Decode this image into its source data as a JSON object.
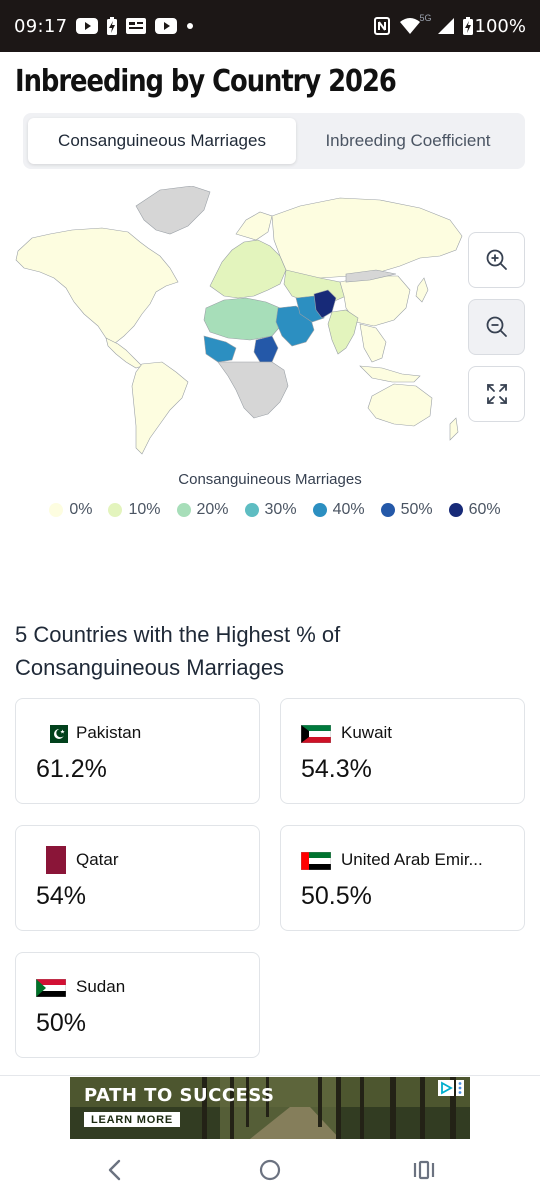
{
  "status_bar": {
    "time": "09:17",
    "battery": "100%",
    "network": "5G",
    "icons": [
      "youtube-icon",
      "battery-saver-icon",
      "news-icon",
      "youtube-icon",
      "notification-dot-icon",
      "nfc-icon",
      "wifi-icon",
      "signal-icon",
      "battery-icon"
    ]
  },
  "page": {
    "title": "Inbreeding by Country 2026"
  },
  "tabs": [
    {
      "label": "Consanguineous Marriages",
      "selected": true
    },
    {
      "label": "Inbreeding Coefficient",
      "selected": false
    }
  ],
  "map": {
    "controls": [
      "zoom-in-icon",
      "zoom-out-icon",
      "fullscreen-icon"
    ],
    "legend_title": "Consanguineous Marriages",
    "legend": [
      {
        "label": "0%",
        "color": "#fdfde0"
      },
      {
        "label": "10%",
        "color": "#e3f4bd"
      },
      {
        "label": "20%",
        "color": "#a7deb9"
      },
      {
        "label": "30%",
        "color": "#5ebdc2"
      },
      {
        "label": "40%",
        "color": "#2c8fc1"
      },
      {
        "label": "50%",
        "color": "#2458a8"
      },
      {
        "label": "60%",
        "color": "#172a78"
      }
    ],
    "no_data_color": "#d6d6d6"
  },
  "top5": {
    "title": "5 Countries with the Highest % of Consanguineous Marriages",
    "countries": [
      {
        "name": "Pakistan",
        "value": "61.2%",
        "flag": "pakistan-flag-icon"
      },
      {
        "name": "Kuwait",
        "value": "54.3%",
        "flag": "kuwait-flag-icon"
      },
      {
        "name": "Qatar",
        "value": "54%",
        "flag": "qatar-flag-icon"
      },
      {
        "name": "United Arab Emir...",
        "value": "50.5%",
        "flag": "uae-flag-icon"
      },
      {
        "name": "Sudan",
        "value": "50%",
        "flag": "sudan-flag-icon"
      }
    ]
  },
  "ad": {
    "headline": "PATH TO SUCCESS",
    "cta": "LEARN MORE"
  },
  "nav": [
    "back-icon",
    "home-icon",
    "recents-icon"
  ]
}
